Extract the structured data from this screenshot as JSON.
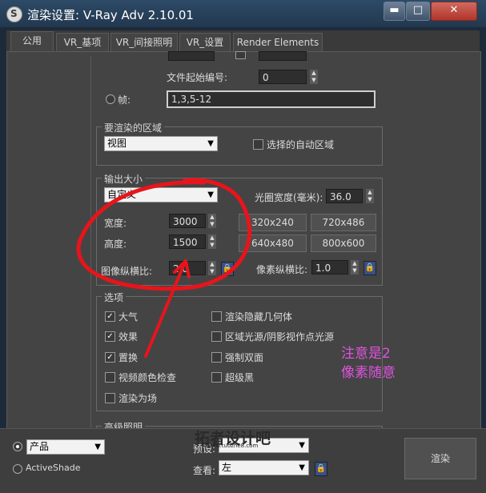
{
  "window": {
    "title": "渲染设置: V-Ray Adv 2.10.01",
    "min_label": "▬",
    "max_label": "□",
    "close_label": "✕"
  },
  "tabs": [
    "公用",
    "VR_基项",
    "VR_间接照明",
    "VR_设置",
    "Render Elements"
  ],
  "frames": {
    "start_number_label": "文件起始编号:",
    "start_number_value": "0",
    "frames_label": "帧:",
    "frames_value": "1,3,5-12"
  },
  "area": {
    "title": "要渲染的区域",
    "dropdown": "视图",
    "auto_region_label": "选择的自动区域"
  },
  "output": {
    "title": "输出大小",
    "preset": "自定义",
    "aperture_label": "光圈宽度(毫米):",
    "aperture_value": "36.0",
    "width_label": "宽度:",
    "width_value": "3000",
    "height_label": "高度:",
    "height_value": "1500",
    "aspect_label": "图像纵横比:",
    "aspect_value": "2.0",
    "pixel_aspect_label": "像素纵横比:",
    "pixel_aspect_value": "1.0",
    "presets": [
      "320x240",
      "720x486",
      "640x480",
      "800x600"
    ]
  },
  "options": {
    "title": "选项",
    "left": [
      {
        "label": "大气",
        "checked": true
      },
      {
        "label": "效果",
        "checked": true
      },
      {
        "label": "置换",
        "checked": true
      },
      {
        "label": "视频颜色检查",
        "checked": false
      },
      {
        "label": "渲染为场",
        "checked": false
      }
    ],
    "right": [
      {
        "label": "渲染隐藏几何体",
        "checked": false
      },
      {
        "label": "区域光源/阴影视作点光源",
        "checked": false
      },
      {
        "label": "强制双面",
        "checked": false
      },
      {
        "label": "超级黑",
        "checked": false
      }
    ]
  },
  "advanced_lighting_title": "高级照明",
  "annotation": {
    "line1": "注意是2",
    "line2": "像素随意"
  },
  "watermark": {
    "text": "拓者设计吧",
    "url": "www.tuozhe8.com"
  },
  "bottom": {
    "product_label": "产品",
    "activeshade_label": "ActiveShade",
    "preset_label": "预设:",
    "view_label": "查看:",
    "view_value": "左",
    "render_button": "渲染"
  },
  "colors": {
    "annotation": "#e052e0",
    "circle": "#e8141b"
  }
}
